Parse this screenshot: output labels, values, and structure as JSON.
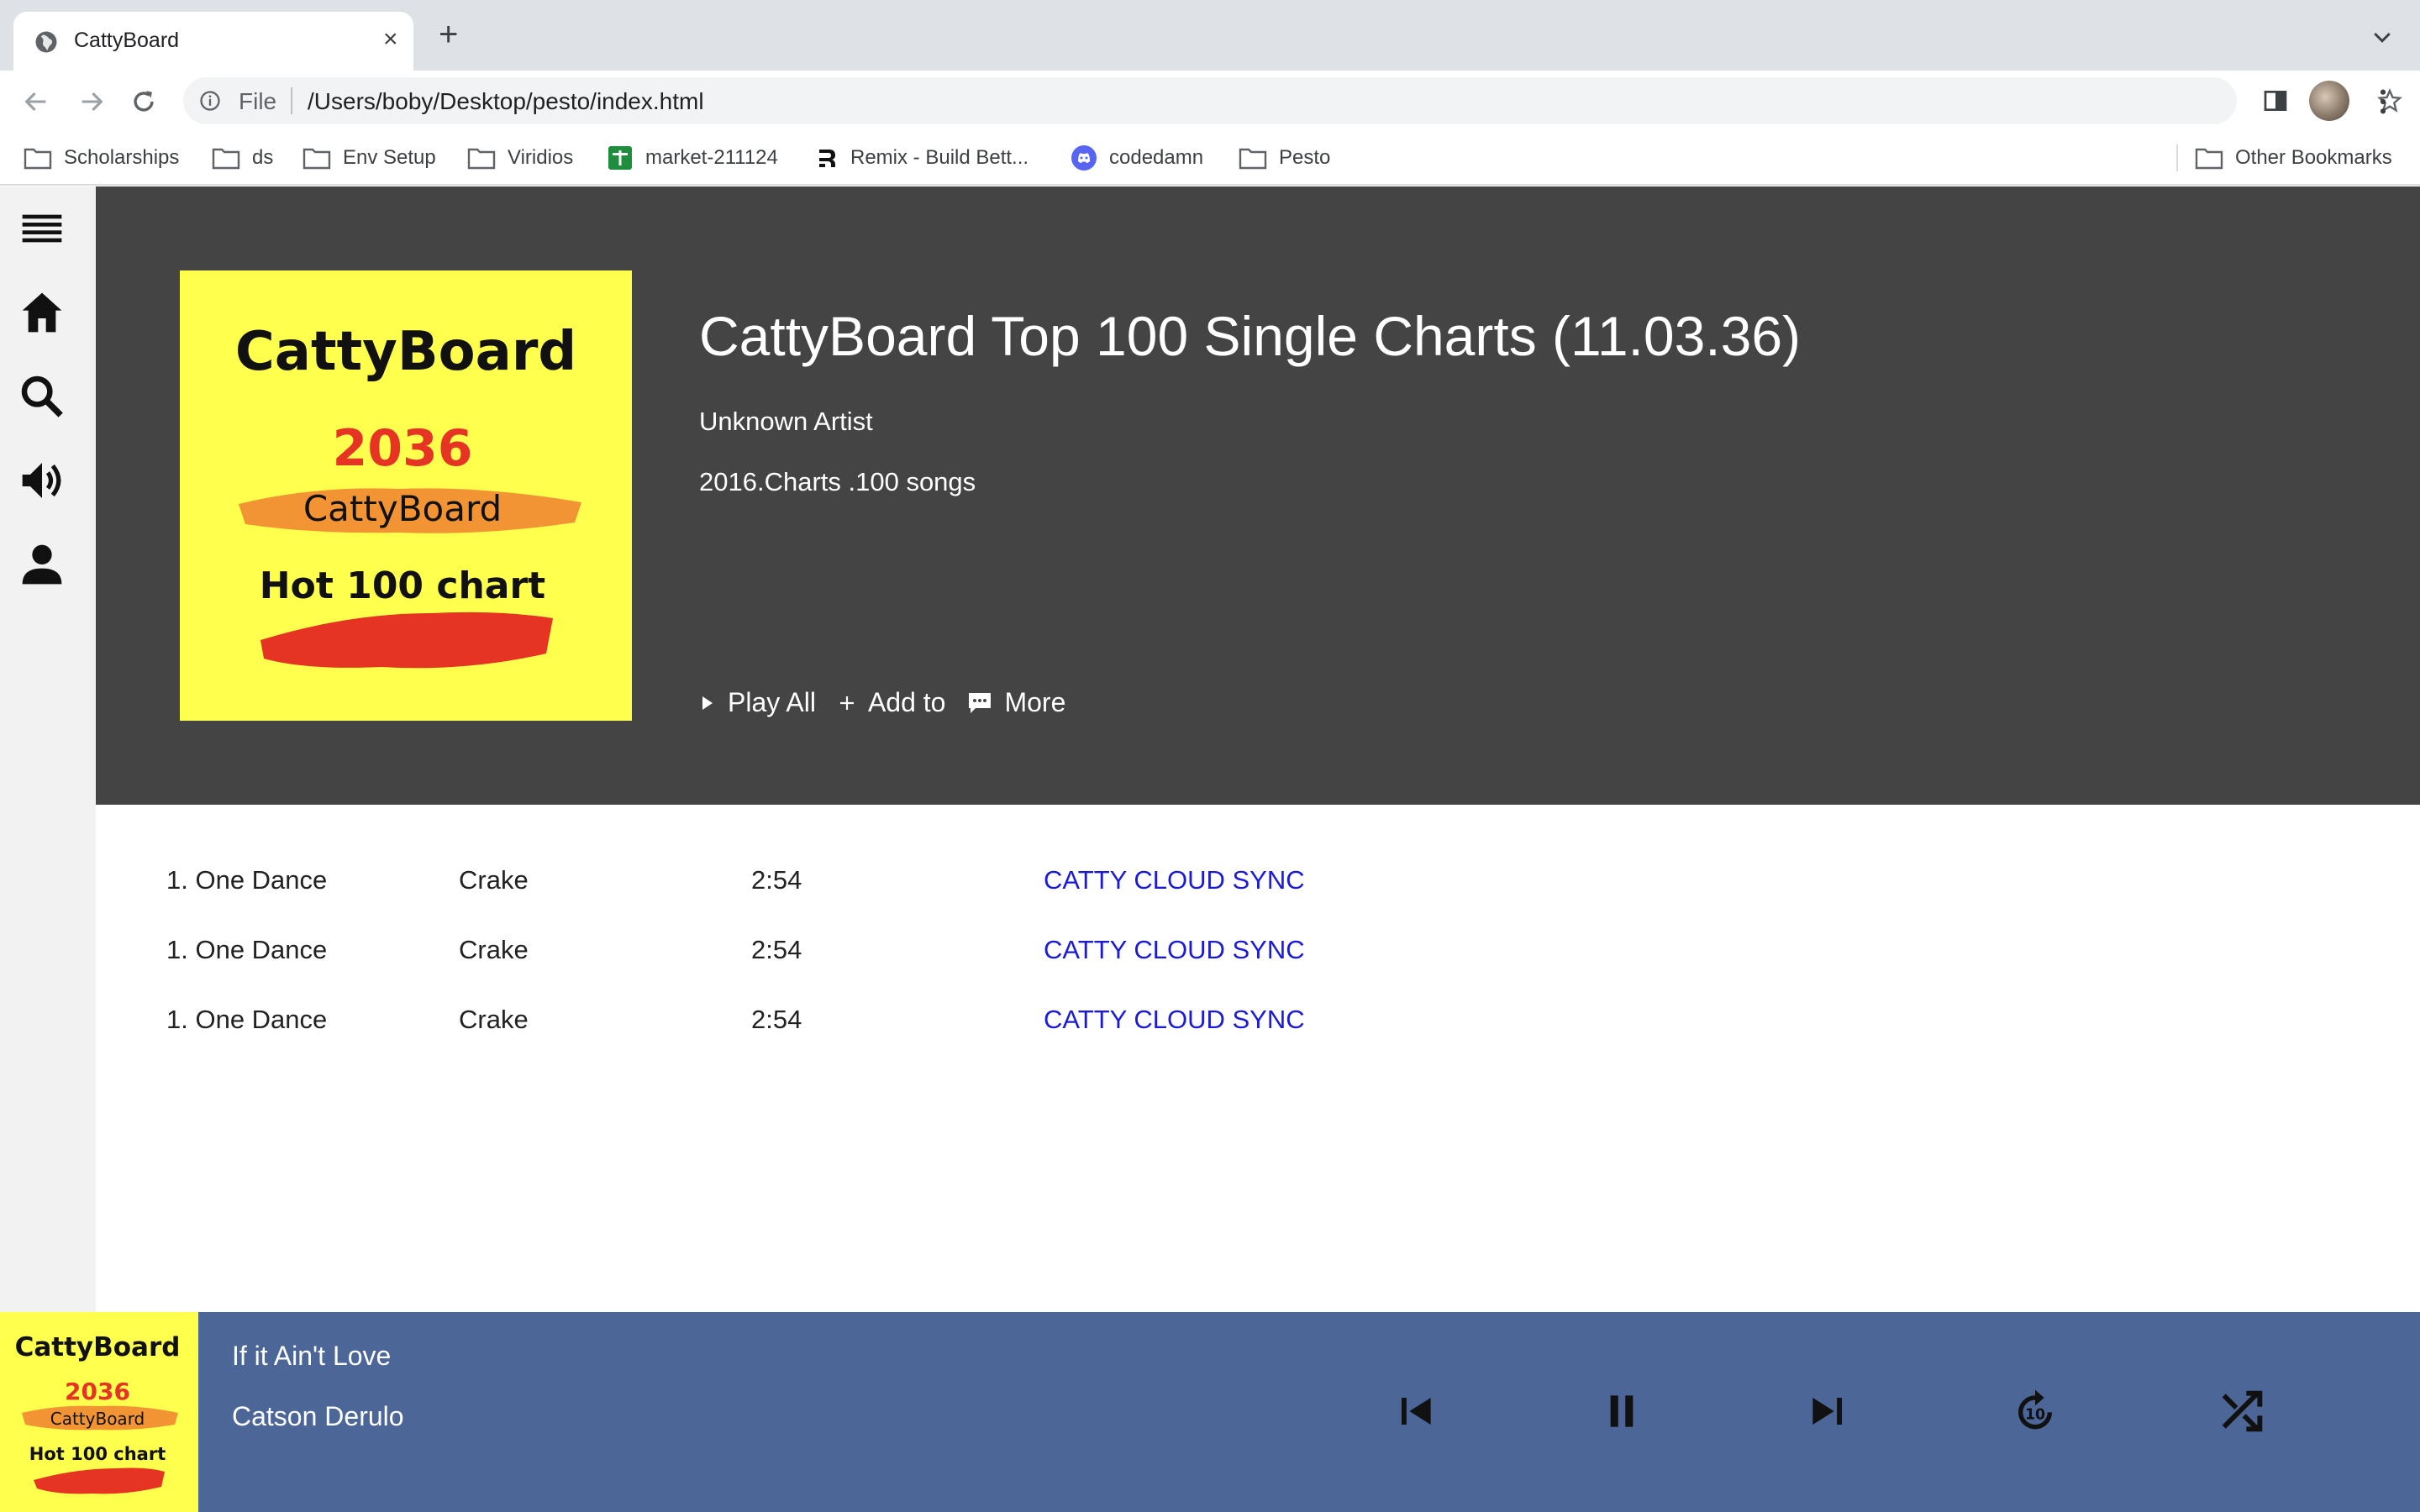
{
  "browser": {
    "tab_title": "CattyBoard",
    "file_label": "File",
    "url": "/Users/boby/Desktop/pesto/index.html",
    "bookmarks": [
      {
        "label": "Scholarships",
        "icon": "folder-icon"
      },
      {
        "label": "ds",
        "icon": "folder-icon"
      },
      {
        "label": "Env Setup",
        "icon": "folder-icon"
      },
      {
        "label": "Viridios",
        "icon": "folder-icon"
      },
      {
        "label": "market-211124",
        "icon": "sheets-icon"
      },
      {
        "label": "Remix - Build Bett...",
        "icon": "remix-icon"
      },
      {
        "label": "codedamn",
        "icon": "discord-icon"
      },
      {
        "label": "Pesto",
        "icon": "folder-icon"
      }
    ],
    "other_bookmarks": "Other Bookmarks"
  },
  "sidebar": {
    "items": [
      "menu-icon",
      "home-icon",
      "search-icon",
      "volume-icon",
      "person-icon"
    ]
  },
  "album": {
    "cover": {
      "brand": "CattyBoard",
      "year": "2036",
      "sub": "CattyBoard",
      "chart": "Hot 100 chart"
    },
    "title": "CattyBoard Top 100 Single Charts (11.03.36)",
    "artist": "Unknown Artist",
    "meta": "2016.Charts .100 songs",
    "actions": {
      "play_all": "Play All",
      "add_to": "Add to",
      "more": "More"
    }
  },
  "tracks": [
    {
      "title": "1. One Dance",
      "artist": "Crake",
      "duration": "2:54",
      "link": "CATTY CLOUD SYNC"
    },
    {
      "title": "1. One Dance",
      "artist": "Crake",
      "duration": "2:54",
      "link": "CATTY CLOUD SYNC"
    },
    {
      "title": "1. One Dance",
      "artist": "Crake",
      "duration": "2:54",
      "link": "CATTY CLOUD SYNC"
    }
  ],
  "player": {
    "song": "If it Ain't Love",
    "artist": "Catson Derulo",
    "controls": [
      "skip-previous-icon",
      "pause-icon",
      "skip-next-icon",
      "forward-10-icon",
      "shuffle-icon"
    ],
    "accent": "#4c6698"
  },
  "colors": {
    "hero_bg": "#444444",
    "cover_bg": "#ffff4d",
    "link": "#1b1bd6"
  }
}
